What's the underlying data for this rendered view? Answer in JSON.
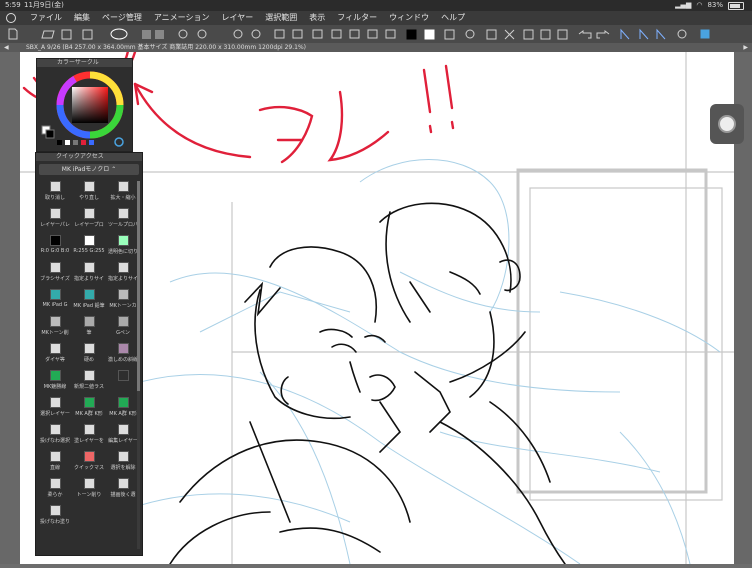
{
  "status": {
    "time": "5:59",
    "date": "11月9日(金)",
    "battery": "83%",
    "battery_level": 0.83
  },
  "menu": {
    "items": [
      "ファイル",
      "編集",
      "ページ管理",
      "アニメーション",
      "レイヤー",
      "選択範囲",
      "表示",
      "フィルター",
      "ウィンドウ",
      "ヘルプ"
    ]
  },
  "tab": {
    "title": "SBX_A 9/26 (B4 257.00 x 364.00mm 基本サイズ 商業誌用 220.00 x 310.00mm 1200dpi 29.1%)",
    "close": "×",
    "left_marker": "◀",
    "right_marker": "▶"
  },
  "color_panel": {
    "title": "カラーサークル",
    "accent": "#e0203a"
  },
  "quick_access": {
    "title": "クイックアクセス",
    "set_name": "MK iPadモノクロ",
    "items": [
      {
        "label": "取り消し",
        "icon": "undo-icon"
      },
      {
        "label": "やり直し",
        "icon": "redo-icon"
      },
      {
        "label": "拡大・縮小",
        "icon": "transform-icon"
      },
      {
        "label": "レイヤーパレ",
        "icon": "layer-palette-icon"
      },
      {
        "label": "レイヤープロ",
        "icon": "layer-property-icon"
      },
      {
        "label": "ツールプロパ",
        "icon": "tool-property-icon"
      },
      {
        "label": "R:0 G:0 B:0",
        "icon": "black-swatch-icon"
      },
      {
        "label": "R:255 G:255",
        "icon": "white-swatch-icon"
      },
      {
        "label": "透明色に切り",
        "icon": "transparent-icon"
      },
      {
        "label": "ブラシサイズ",
        "icon": "brush-size-icon"
      },
      {
        "label": "指定よりサイ",
        "icon": "size-up-icon"
      },
      {
        "label": "指定よりサイ",
        "icon": "size-down-icon"
      },
      {
        "label": "MK iPad G",
        "icon": "pen-g-icon"
      },
      {
        "label": "MK iPad 鉛筆",
        "icon": "pencil-icon"
      },
      {
        "label": "MKトーンカ",
        "icon": "tone-cut-icon"
      },
      {
        "label": "MKトーン削",
        "icon": "tone-erase-icon"
      },
      {
        "label": "筆",
        "icon": "brush-icon"
      },
      {
        "label": "Gペン",
        "icon": "gpen-icon"
      },
      {
        "label": "ダイヤ等",
        "icon": "diamond-icon"
      },
      {
        "label": "硬め",
        "icon": "hard-eraser-icon"
      },
      {
        "label": "激しめの斜線",
        "icon": "hatch-icon"
      },
      {
        "label": "MK魅勝線",
        "icon": "speedline-icon"
      },
      {
        "label": "新規二値ラス",
        "icon": "new-raster-icon"
      },
      {
        "label": "",
        "icon": "blank-icon"
      },
      {
        "label": "選択レイヤー",
        "icon": "select-layer-icon"
      },
      {
        "label": "MK A群 K形",
        "icon": "mk-a-icon"
      },
      {
        "label": "MK A群 K形",
        "icon": "mk-a2-icon"
      },
      {
        "label": "投げなわ選択",
        "icon": "lasso-select-icon"
      },
      {
        "label": "塗レイヤーを",
        "icon": "fill-layer-icon"
      },
      {
        "label": "編集レイヤー",
        "icon": "edit-layer-icon"
      },
      {
        "label": "直線",
        "icon": "line-icon"
      },
      {
        "label": "クイックマス",
        "icon": "quick-mask-icon"
      },
      {
        "label": "選択を解除",
        "icon": "deselect-icon"
      },
      {
        "label": "柔らか",
        "icon": "soft-icon"
      },
      {
        "label": "トーン削り",
        "icon": "tone-scrape-icon"
      },
      {
        "label": "描画後く選",
        "icon": "draw-select-icon"
      },
      {
        "label": "投げなわ塗り",
        "icon": "lasso-fill-icon"
      }
    ]
  },
  "annotation": {
    "text": "コレ!!",
    "color": "#e0203a"
  },
  "colors": {
    "ui_dark": "#2e2e2e",
    "menubar": "#3a3a3a",
    "line_blue": "#9cc6df",
    "ink": "#111111"
  }
}
